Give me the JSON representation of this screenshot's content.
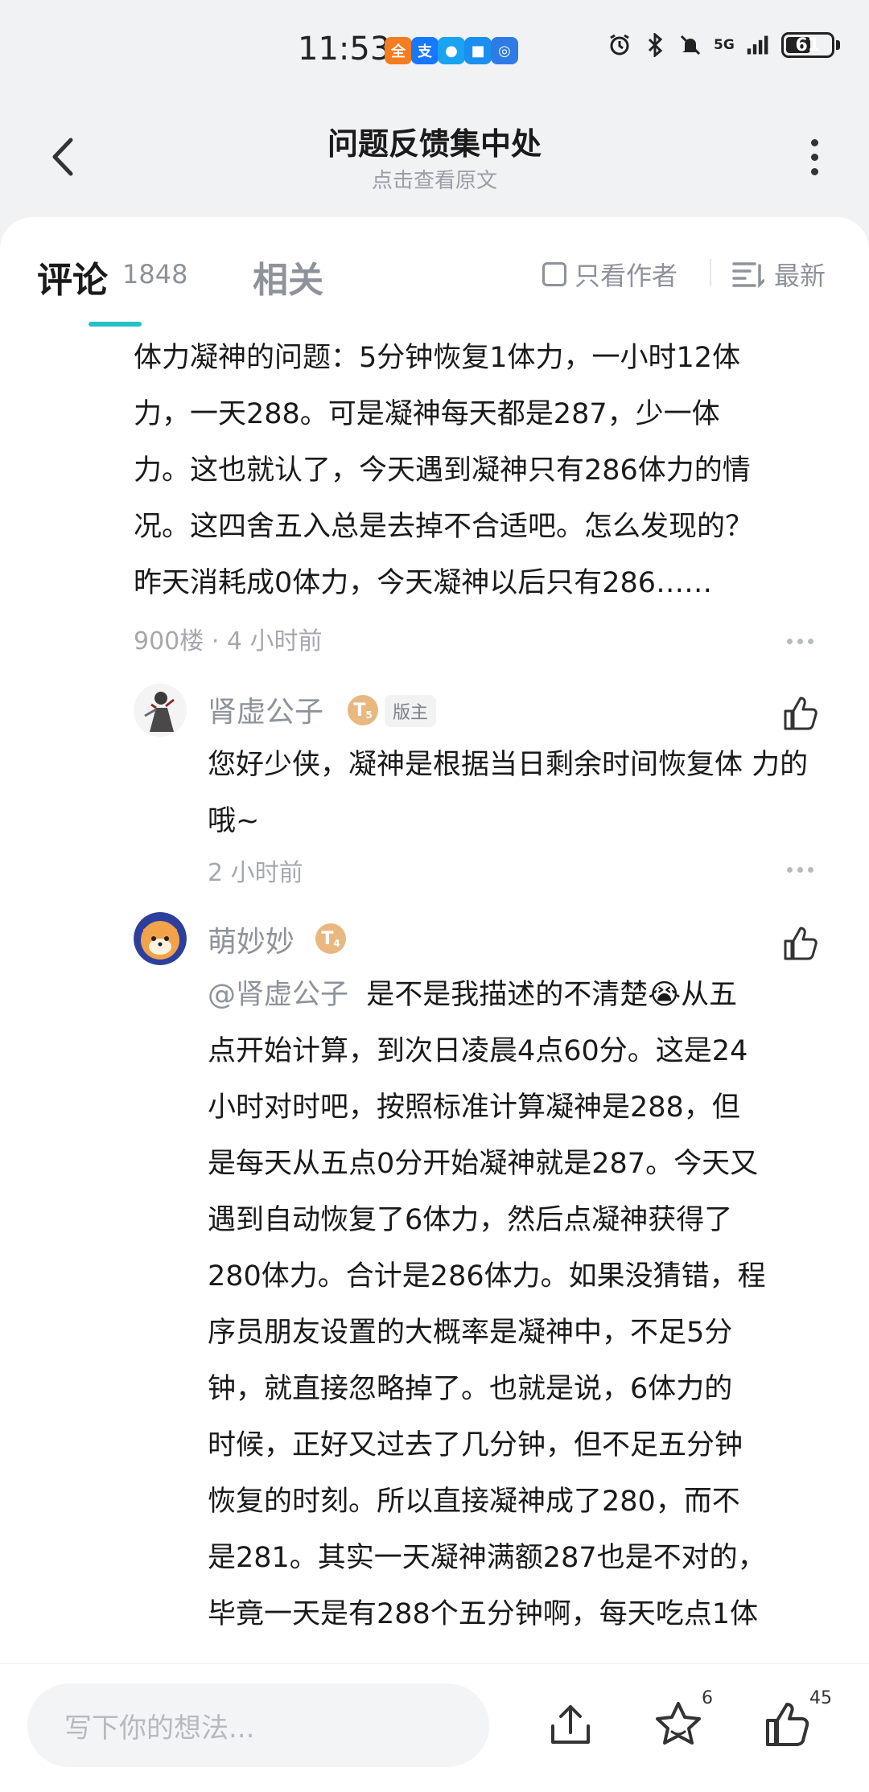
{
  "status_bar": {
    "time": "11:53",
    "network": "5G",
    "battery": "61",
    "app_icons": [
      {
        "name": "meituan-icon",
        "color": "#f57c1f",
        "glyph": "全"
      },
      {
        "name": "alipay-icon",
        "color": "#1677ff",
        "glyph": "支"
      },
      {
        "name": "chat-icon",
        "color": "#1aa3f0",
        "glyph": "●"
      },
      {
        "name": "message-icon",
        "color": "#1b8ff0",
        "glyph": "■"
      },
      {
        "name": "app-icon",
        "color": "#2f7be6",
        "glyph": "◎"
      }
    ]
  },
  "header": {
    "title": "问题反馈集中处",
    "subtitle": "点击查看原文"
  },
  "tabs": {
    "comment_label": "评论",
    "comment_count": "1848",
    "related_label": "相关",
    "author_only_label": "只看作者",
    "sort_label": "最新"
  },
  "accent_color": "#23c1c9",
  "main_comment": {
    "text": "体力凝神的问题：5分钟恢复1体力，一小时12体\n力，一天288。可是凝神每天都是287，少一体\n力。这也就认了，今天遇到凝神只有286体力的情\n况。这四舍五入总是去掉不合适吧。怎么发现的？\n昨天消耗成0体力，今天凝神以后只有286……",
    "floor": "900楼",
    "separator": "·",
    "time": "4 小时前"
  },
  "replies": [
    {
      "username": "肾虚公子",
      "level": "T",
      "level_sub": "5",
      "role": "版主",
      "text": "您好少侠，凝神是根据当日剩余时间恢复体\n力的哦~",
      "time": "2 小时前"
    },
    {
      "username": "萌妙妙",
      "level": "T",
      "level_sub": "4",
      "mention": "@肾虚公子",
      "text_first": "是不是我描述的不清楚😭从五",
      "text": "点开始计算，到次日凌晨4点60分。这是24\n小时对时吧，按照标准计算凝神是288，但\n是每天从五点0分开始凝神就是287。今天又\n遇到自动恢复了6体力，然后点凝神获得了\n280体力。合计是286体力。如果没猜错，程\n序员朋友设置的大概率是凝神中，不足5分\n钟，就直接忽略掉了。也就是说，6体力的\n时候，正好又过去了几分钟，但不足五分钟\n恢复的时刻。所以直接凝神成了280，而不\n是281。其实一天凝神满额287也是不对的，\n毕竟一天是有288个五分钟啊，每天吃点1体"
    }
  ],
  "bottom_bar": {
    "input_placeholder": "写下你的想法...",
    "favorite_count": "6",
    "like_count": "45"
  }
}
